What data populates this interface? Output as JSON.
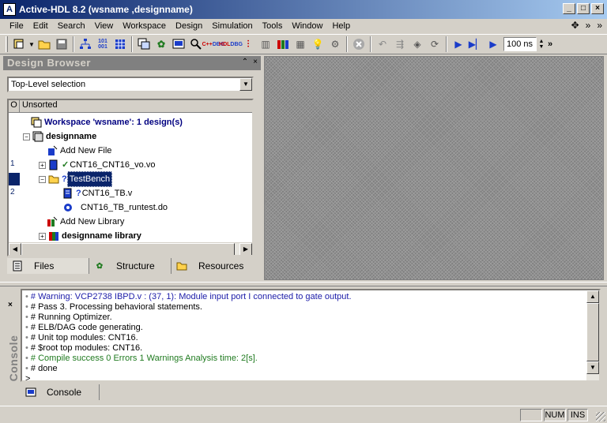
{
  "window": {
    "title": "Active-HDL 8.2 (wsname ,designname)",
    "app_icon_text": "A",
    "min_label": "_",
    "max_label": "□",
    "close_label": "×"
  },
  "menu": [
    "File",
    "Edit",
    "Search",
    "View",
    "Workspace",
    "Design",
    "Simulation",
    "Tools",
    "Window",
    "Help"
  ],
  "toolbar": {
    "time_value": "100 ns"
  },
  "design_browser": {
    "title": "Design Browser",
    "selection": "Top-Level selection",
    "col_o": "O",
    "col_sort": "Unsorted",
    "tree": {
      "workspace": "Workspace 'wsname': 1 design(s)",
      "design": "designname",
      "add_new_file": "Add New File",
      "file1_num": "1",
      "file1": "CNT16_CNT16_vo.vo",
      "testbench": "TestBench",
      "file2_num": "2",
      "file2": "CNT16_TB.v",
      "file3": "CNT16_TB_runtest.do",
      "add_new_library": "Add New Library",
      "library": "designname library"
    },
    "tabs": [
      "Files",
      "Structure",
      "Resources"
    ]
  },
  "console": {
    "side_label": "Console",
    "side_close": "×",
    "tab_label": "Console",
    "lines": [
      {
        "text": "# Warning: VCP2738 IBPD.v : (37, 1): Module input port I connected to gate output.",
        "color": "#1b1ba8"
      },
      {
        "text": "# Pass 3. Processing behavioral statements.",
        "color": "#000000"
      },
      {
        "text": "# Running Optimizer.",
        "color": "#000000"
      },
      {
        "text": "# ELB/DAG code generating.",
        "color": "#000000"
      },
      {
        "text": "# Unit top modules: CNT16.",
        "color": "#000000"
      },
      {
        "text": "# $root top modules: CNT16.",
        "color": "#000000"
      },
      {
        "text": "# Compile success 0 Errors 1 Warnings  Analysis time: 2[s].",
        "color": "#1f7a1f"
      },
      {
        "text": "# done",
        "color": "#000000"
      },
      {
        "text": ">",
        "color": "#000000"
      }
    ]
  },
  "status": {
    "num": "NUM",
    "ins": "INS"
  },
  "colors": {
    "titlebar_start": "#0a246a",
    "selection": "#0a246a",
    "warning": "#1b1ba8",
    "success": "#1f7a1f"
  }
}
